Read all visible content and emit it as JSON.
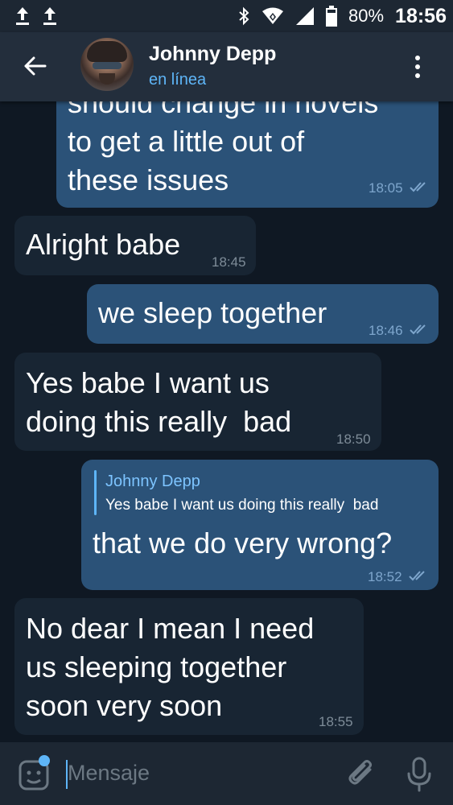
{
  "status_bar": {
    "left_icons": [
      "upload-arrow-icon",
      "upload-arrow-icon"
    ],
    "right_icons": [
      "bluetooth-icon",
      "wifi-icon",
      "signal-icon",
      "battery-icon"
    ],
    "battery": "80%",
    "time": "18:56"
  },
  "header": {
    "contact_name": "Johnny Depp",
    "status": "en línea",
    "icons": [
      "back-arrow-icon",
      "avatar",
      "more-vertical-icon"
    ]
  },
  "messages": [
    {
      "direction": "out",
      "text": "should change in novels\nto get a little out of\nthese issues",
      "time": "18:05",
      "read": true
    },
    {
      "direction": "in",
      "text": "Alright babe",
      "time": "18:45"
    },
    {
      "direction": "out",
      "text": "we sleep together",
      "time": "18:46",
      "read": true
    },
    {
      "direction": "in",
      "text": "Yes babe I want us\ndoing this really  bad",
      "time": "18:50"
    },
    {
      "direction": "out",
      "reply_to": {
        "name": "Johnny Depp",
        "text": "Yes babe I want us doing this really  bad"
      },
      "text": "that we do very wrong?",
      "time": "18:52",
      "read": true
    },
    {
      "direction": "in",
      "text": "No dear I mean I need\nus sleeping together\nsoon very soon",
      "time": "18:55"
    }
  ],
  "input_bar": {
    "placeholder": "Mensaje",
    "icons": [
      "emoji-icon",
      "attach-icon",
      "microphone-icon"
    ]
  },
  "colors": {
    "background": "#0f1823",
    "header": "#232e3c",
    "outgoing_bubble": "#2b5278",
    "incoming_bubble": "#182533",
    "accent": "#5eb5f7"
  }
}
